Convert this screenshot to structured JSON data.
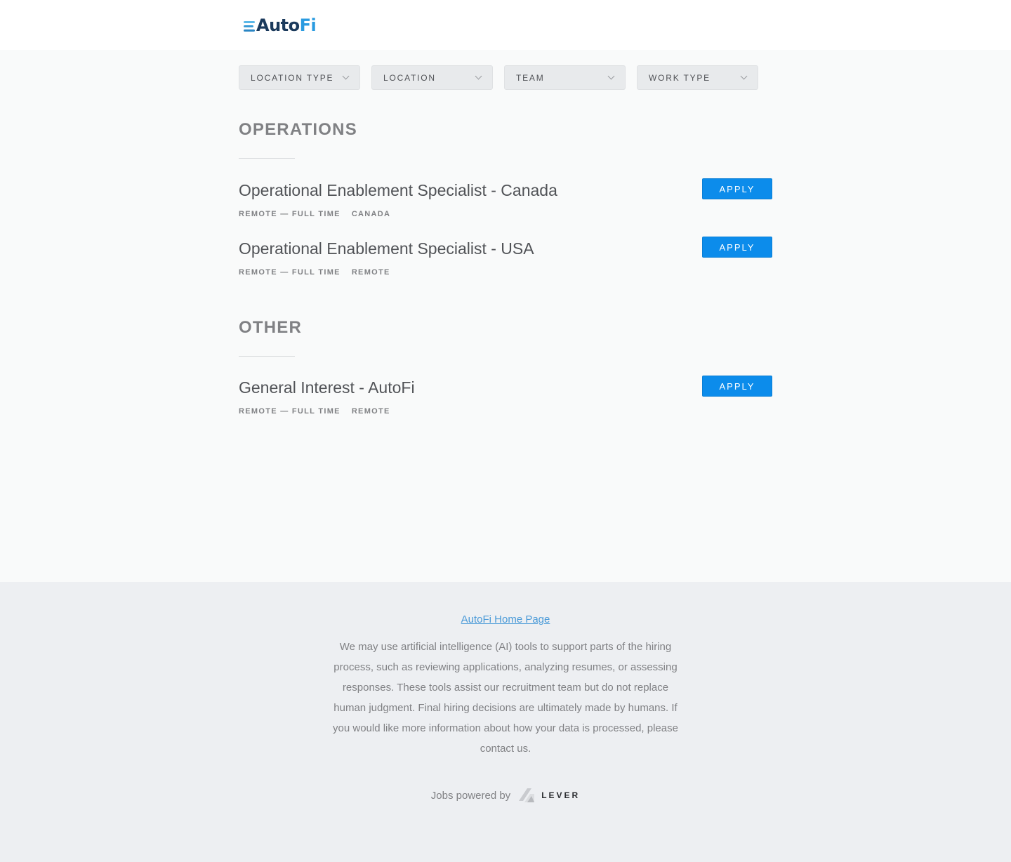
{
  "header": {
    "logo_auto": "Auto",
    "logo_fi": "Fi"
  },
  "filters": [
    {
      "label": "LOCATION TYPE"
    },
    {
      "label": "LOCATION"
    },
    {
      "label": "TEAM"
    },
    {
      "label": "WORK TYPE"
    }
  ],
  "sections": [
    {
      "title": "OPERATIONS",
      "postings": [
        {
          "title": "Operational Enablement Specialist - Canada",
          "commitment": "REMOTE — FULL TIME",
          "location": "CANADA",
          "apply_label": "APPLY"
        },
        {
          "title": "Operational Enablement Specialist - USA",
          "commitment": "REMOTE — FULL TIME",
          "location": "REMOTE",
          "apply_label": "APPLY"
        }
      ]
    },
    {
      "title": "OTHER",
      "postings": [
        {
          "title": "General Interest - AutoFi",
          "commitment": "REMOTE — FULL TIME",
          "location": "REMOTE",
          "apply_label": "APPLY"
        }
      ]
    }
  ],
  "footer": {
    "home_link": "AutoFi Home Page",
    "ai_notice": "We may use artificial intelligence (AI) tools to support parts of the hiring process, such as reviewing applications, analyzing resumes, or assessing responses. These tools assist our recruitment team but do not replace human judgment. Final hiring decisions are ultimately made by humans. If you would like more information about how your data is processed, please contact us.",
    "powered_by": "Jobs powered by",
    "lever_word": "LEVER"
  }
}
